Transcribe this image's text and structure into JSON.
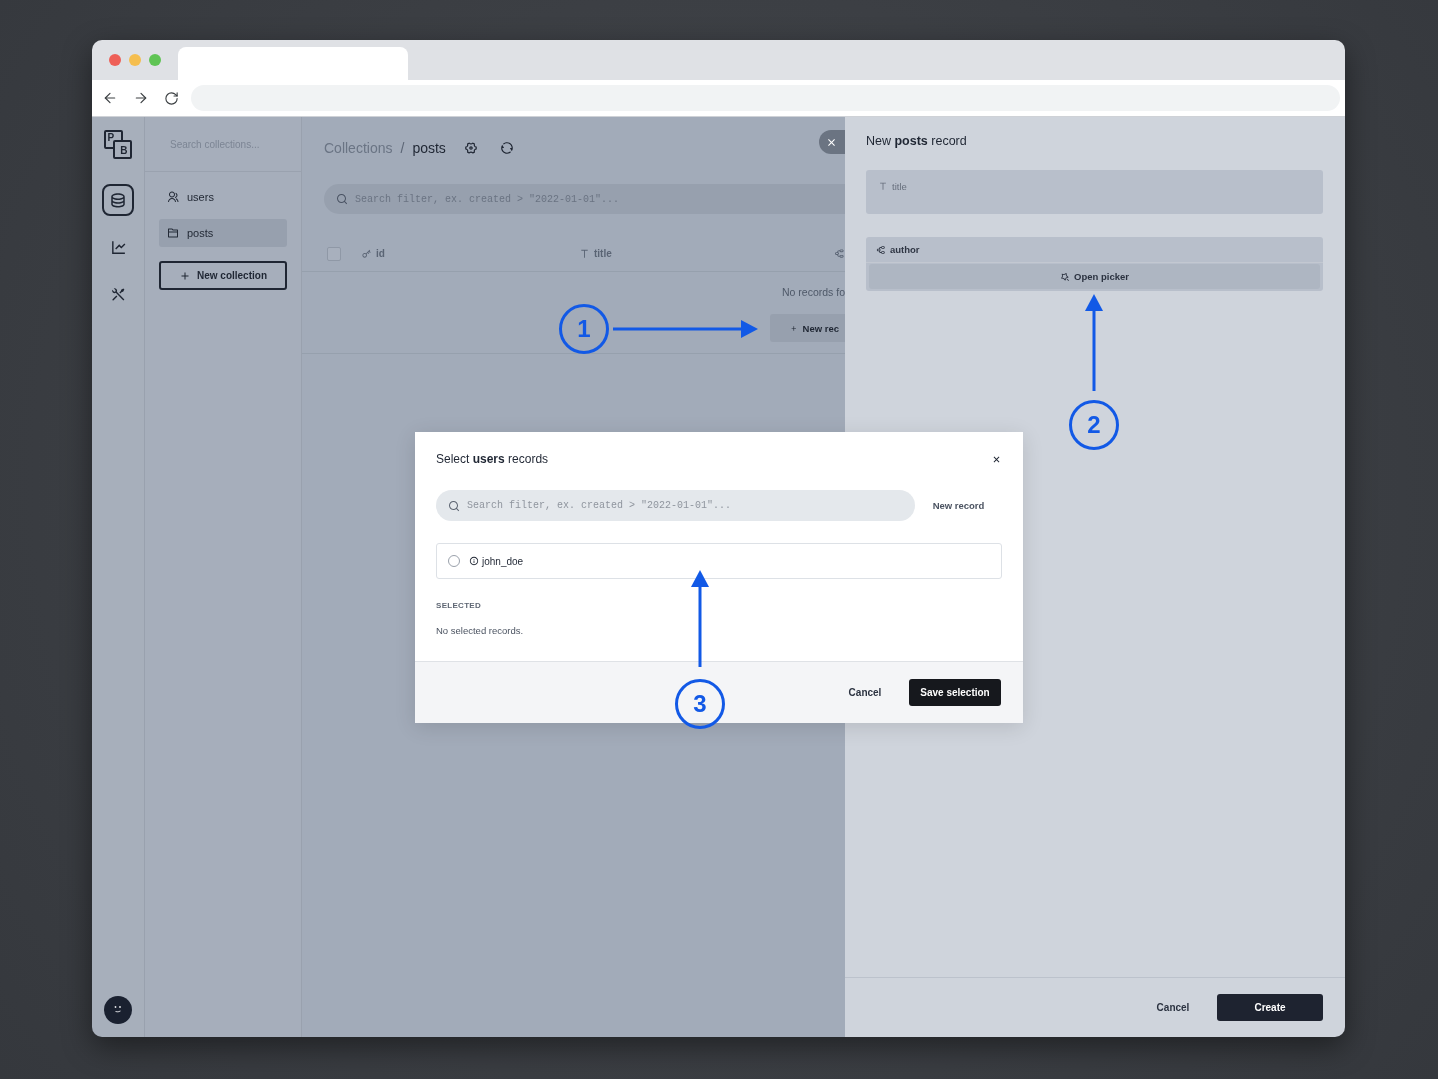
{
  "nav": {
    "logo": {
      "top": "P",
      "bottom": "B"
    },
    "items": [
      {
        "kind": "database",
        "selected": true
      },
      {
        "kind": "chart",
        "selected": false
      },
      {
        "kind": "tools",
        "selected": false
      }
    ]
  },
  "sidebar": {
    "search": {
      "placeholder": "Search collections..."
    },
    "items": [
      {
        "kind": "auth",
        "label": "users",
        "selected": false
      },
      {
        "kind": "base",
        "label": "posts",
        "selected": true
      }
    ],
    "new_button": "New collection"
  },
  "main": {
    "breadcrumb": {
      "parent": "Collections",
      "separator": "/",
      "current": "posts"
    },
    "search": {
      "placeholder": "Search filter, ex. created > \"2022-01-01\"..."
    },
    "table": {
      "select_all": {
        "checked": false
      },
      "columns": [
        {
          "kind": "id",
          "label": "id"
        },
        {
          "kind": "text",
          "label": "title"
        },
        {
          "kind": "relation"
        }
      ],
      "empty_text": "No records fo",
      "new_button": "New rec"
    }
  },
  "panel": {
    "title": "New **posts** record",
    "fields": [
      {
        "kind": "text",
        "label": "title"
      },
      {
        "kind": "relation",
        "label": "author",
        "button": "Open picker"
      }
    ],
    "cancel": "Cancel",
    "submit": "Create"
  },
  "modal": {
    "title": "Select **users** records",
    "search": {
      "placeholder": "Search filter, ex. created > \"2022-01-01\"..."
    },
    "new_record": "New record",
    "records": [
      {
        "label": "john_doe",
        "selected": false
      }
    ],
    "selected_heading": "SELECTED",
    "empty_text": "No selected records.",
    "cancel": "Cancel",
    "save": "Save selection"
  },
  "annotations": [
    {
      "label": "1"
    },
    {
      "label": "2"
    },
    {
      "label": "3"
    }
  ]
}
